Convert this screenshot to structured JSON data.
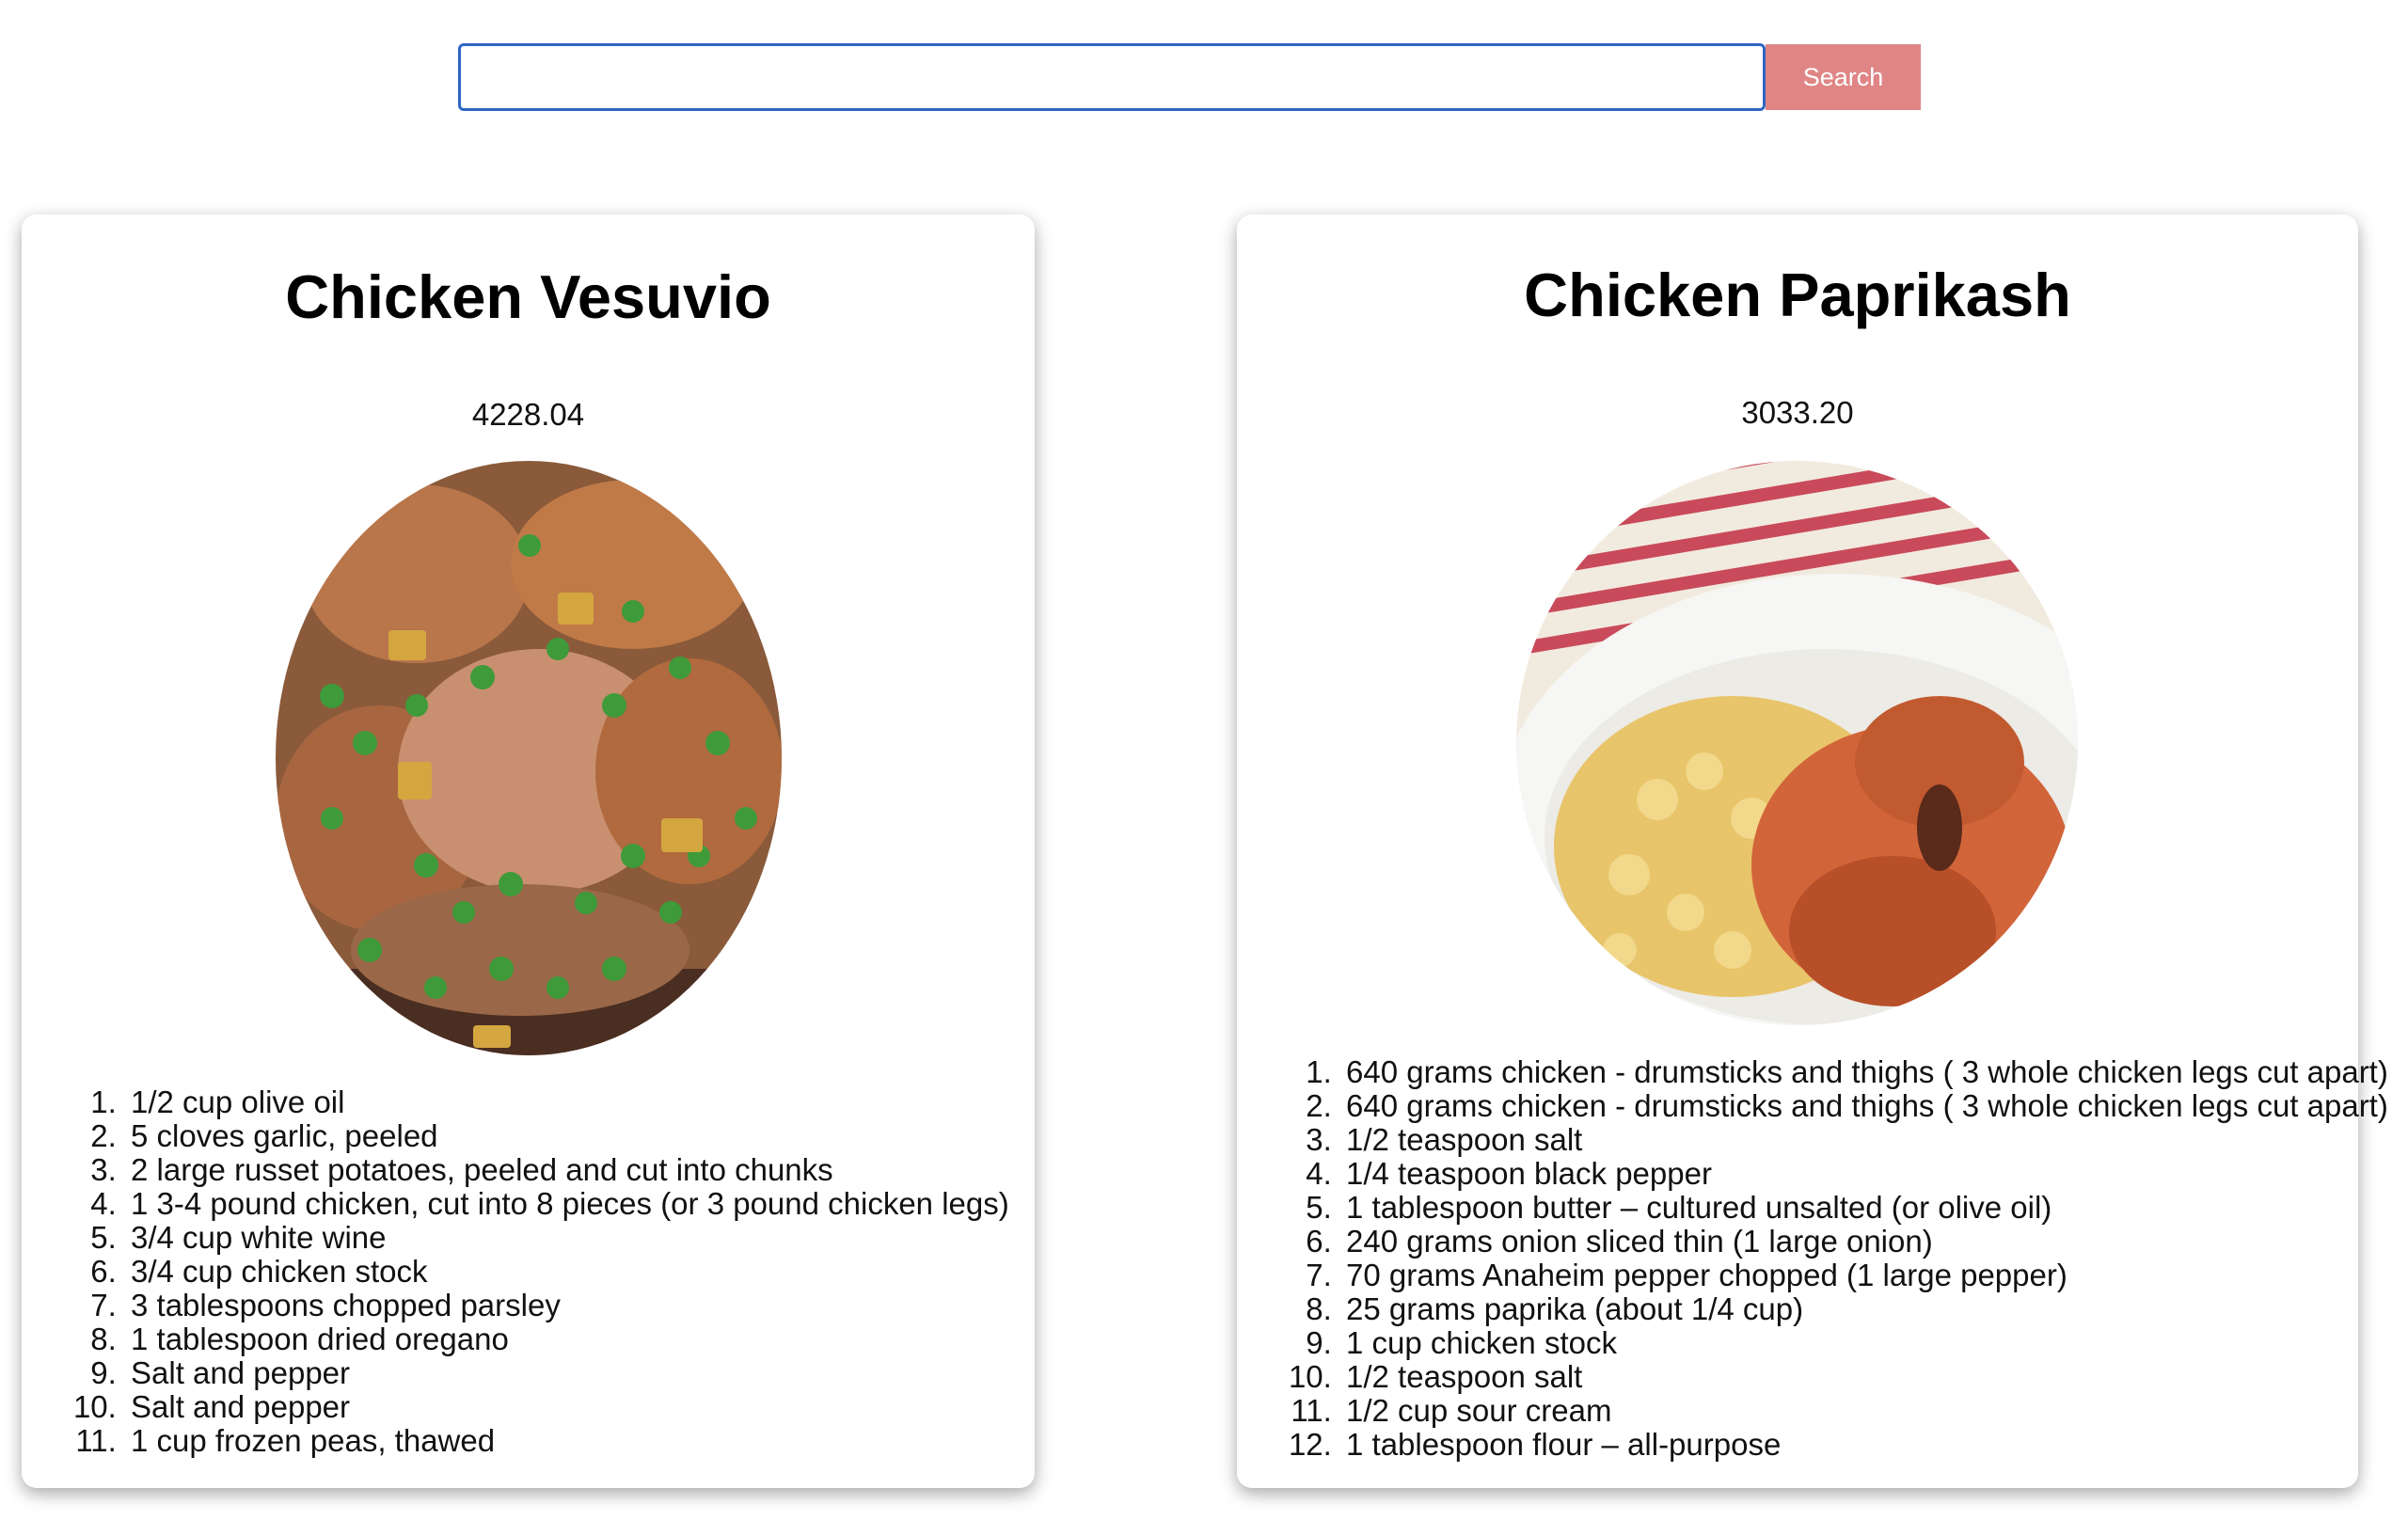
{
  "search": {
    "placeholder": "",
    "button_label": "Search"
  },
  "recipes": [
    {
      "title": "Chicken Vesuvio",
      "value": "4228.04",
      "ingredients": [
        "1/2 cup olive oil",
        "5 cloves garlic, peeled",
        "2 large russet potatoes, peeled and cut into chunks",
        "1 3-4 pound chicken, cut into 8 pieces (or 3 pound chicken legs)",
        "3/4 cup white wine",
        "3/4 cup chicken stock",
        "3 tablespoons chopped parsley",
        "1 tablespoon dried oregano",
        "Salt and pepper",
        "Salt and pepper",
        "1 cup frozen peas, thawed"
      ]
    },
    {
      "title": "Chicken Paprikash",
      "value": "3033.20",
      "ingredients": [
        "640 grams chicken - drumsticks and thighs ( 3 whole chicken legs cut apart)",
        "640 grams chicken - drumsticks and thighs ( 3 whole chicken legs cut apart)",
        "1/2 teaspoon salt",
        "1/4 teaspoon black pepper",
        "1 tablespoon butter – cultured unsalted (or olive oil)",
        "240 grams onion sliced thin (1 large onion)",
        "70 grams Anaheim pepper chopped (1 large pepper)",
        "25 grams paprika (about 1/4 cup)",
        "1 cup chicken stock",
        "1/2 teaspoon salt",
        "1/2 cup sour cream",
        "1 tablespoon flour – all-purpose"
      ]
    }
  ]
}
